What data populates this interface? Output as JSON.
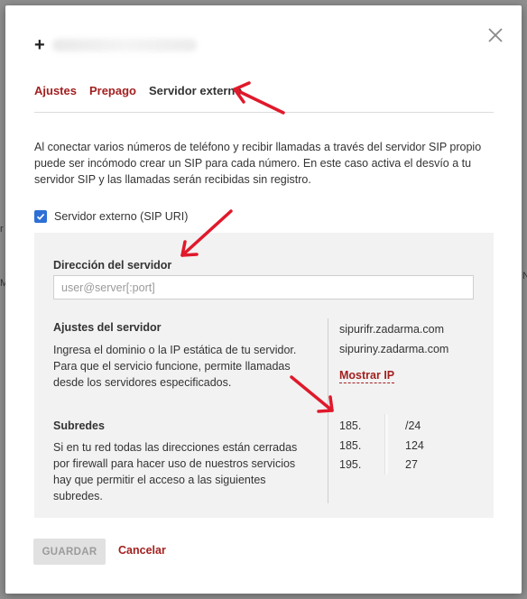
{
  "backdrop": {
    "left_fragments": [
      "r",
      "M"
    ],
    "right_fragments": [
      "",
      "N"
    ]
  },
  "dialog": {
    "title_icon": "plus-icon",
    "close_icon": "close-icon",
    "tabs": [
      {
        "label": "Ajustes",
        "active": false
      },
      {
        "label": "Prepago",
        "active": false
      },
      {
        "label": "Servidor externo",
        "active": true
      }
    ],
    "description": "Al conectar varios números de teléfono y recibir llamadas a través del servidor SIP propio puede ser incómodo crear un SIP para cada número. En este caso activa el desvío a tu servidor SIP y las llamadas serán recibidas sin registro.",
    "external_server": {
      "label": "Servidor externo (SIP URI)",
      "checked": true
    },
    "server_address": {
      "label": "Dirección del servidor",
      "value": "",
      "placeholder": "user@server[:port]"
    },
    "server_settings": {
      "title": "Ajustes del servidor",
      "text": "Ingresa el dominio o la IP estática de tu servidor. Para que el servicio funcione, permite llamadas desde los servidores especificados.",
      "servers": [
        "sipurifr.zadarma.com",
        "sipuriny.zadarma.com"
      ],
      "show_ip_label": "Mostrar IP"
    },
    "subnets": {
      "title": "Subredes",
      "text": "Si en tu red todas las direcciones están cerradas por firewall para hacer uso de nuestros servicios hay que permitir el acceso a las siguientes subredes.",
      "items": [
        {
          "start": "185.",
          "end": "/24"
        },
        {
          "start": "185.",
          "end": "124"
        },
        {
          "start": "195.",
          "end": "27"
        }
      ]
    },
    "save_label": "GUARDAR",
    "cancel_label": "Cancelar"
  },
  "colors": {
    "accent": "#a32020",
    "checkbox": "#2d6fd6",
    "panel": "#f2f2f2",
    "annotation": "#e0192b"
  }
}
